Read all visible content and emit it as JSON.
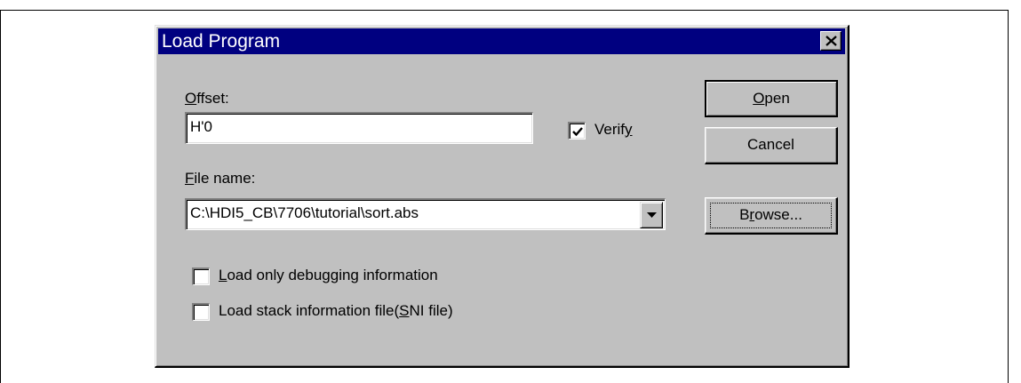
{
  "dialog": {
    "title": "Load Program",
    "offset": {
      "mnemonic": "O",
      "label_rest": "ffset:",
      "value": "H'0"
    },
    "verify": {
      "label_pre": "Verif",
      "mnemonic": "y",
      "checked": true
    },
    "file_name": {
      "mnemonic": "F",
      "label_rest": "ile name:",
      "value": "C:\\HDI5_CB\\7706\\tutorial\\sort.abs"
    },
    "options": [
      {
        "pre": "",
        "mnemonic": "L",
        "post": "oad only debugging information",
        "checked": false
      },
      {
        "pre": "Load stack information file(",
        "mnemonic": "S",
        "post": "NI file)",
        "checked": false
      }
    ],
    "buttons": {
      "open": {
        "mnemonic": "O",
        "rest": "pen"
      },
      "cancel": {
        "label": "Cancel"
      },
      "browse": {
        "pre": "B",
        "mnemonic": "r",
        "post": "owse..."
      }
    },
    "icons": {
      "close": "close-icon",
      "dropdown": "chevron-down-icon",
      "check": "checkmark-icon"
    },
    "colors": {
      "titlebar": "#000080",
      "face": "#c0c0c0"
    }
  }
}
